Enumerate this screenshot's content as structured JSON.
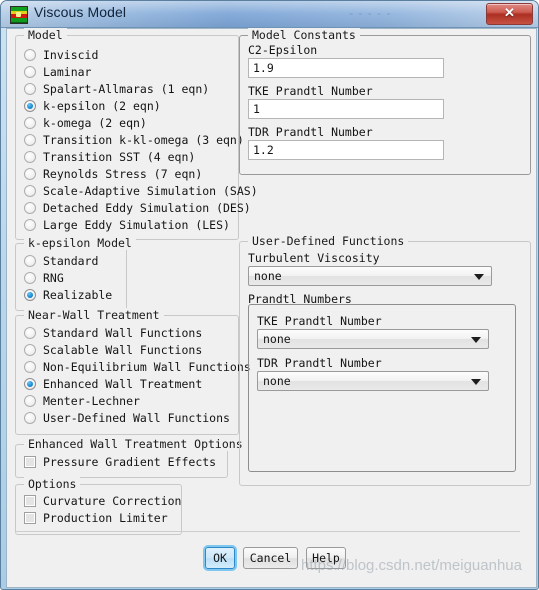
{
  "window": {
    "title": "Viscous Model",
    "icon": "contour-plot-icon",
    "ghost_text": "- - - - -",
    "close_label": "✕",
    "watermark": "https://blog.csdn.net/meiguanhua"
  },
  "model_group": {
    "title": "Model",
    "items": [
      {
        "label": "Inviscid",
        "selected": false
      },
      {
        "label": "Laminar",
        "selected": false
      },
      {
        "label": "Spalart-Allmaras (1 eqn)",
        "selected": false
      },
      {
        "label": "k-epsilon (2 eqn)",
        "selected": true
      },
      {
        "label": "k-omega (2 eqn)",
        "selected": false
      },
      {
        "label": "Transition k-kl-omega (3 eqn)",
        "selected": false
      },
      {
        "label": "Transition SST (4 eqn)",
        "selected": false
      },
      {
        "label": "Reynolds Stress (7 eqn)",
        "selected": false
      },
      {
        "label": "Scale-Adaptive Simulation (SAS)",
        "selected": false
      },
      {
        "label": "Detached Eddy Simulation (DES)",
        "selected": false
      },
      {
        "label": "Large Eddy Simulation (LES)",
        "selected": false
      }
    ]
  },
  "kepsilon_group": {
    "title": "k-epsilon Model",
    "items": [
      {
        "label": "Standard",
        "selected": false
      },
      {
        "label": "RNG",
        "selected": false
      },
      {
        "label": "Realizable",
        "selected": true
      }
    ]
  },
  "nearwall_group": {
    "title": "Near-Wall Treatment",
    "items": [
      {
        "label": "Standard Wall Functions",
        "selected": false
      },
      {
        "label": "Scalable Wall Functions",
        "selected": false
      },
      {
        "label": "Non-Equilibrium Wall Functions",
        "selected": false
      },
      {
        "label": "Enhanced Wall Treatment",
        "selected": true
      },
      {
        "label": "Menter-Lechner",
        "selected": false
      },
      {
        "label": "User-Defined Wall Functions",
        "selected": false
      }
    ]
  },
  "ewt_options_group": {
    "title": "Enhanced Wall Treatment Options",
    "items": [
      {
        "label": "Pressure Gradient Effects",
        "checked": false
      }
    ]
  },
  "options_group": {
    "title": "Options",
    "items": [
      {
        "label": "Curvature Correction",
        "checked": false
      },
      {
        "label": "Production Limiter",
        "checked": false
      }
    ]
  },
  "model_constants_group": {
    "title": "Model Constants",
    "fields": [
      {
        "label": "C2-Epsilon",
        "value": "1.9"
      },
      {
        "label": "TKE Prandtl Number",
        "value": "1"
      },
      {
        "label": "TDR Prandtl Number",
        "value": "1.2"
      }
    ]
  },
  "udf_group": {
    "title": "User-Defined Functions",
    "turbulent_viscosity": {
      "label": "Turbulent Viscosity",
      "value": "none"
    },
    "prandtl_numbers": {
      "title": "Prandtl Numbers",
      "fields": [
        {
          "label": "TKE Prandtl Number",
          "value": "none"
        },
        {
          "label": "TDR Prandtl Number",
          "value": "none"
        }
      ]
    }
  },
  "footer": {
    "buttons": [
      {
        "label": "OK",
        "focused": true
      },
      {
        "label": "Cancel",
        "focused": false
      },
      {
        "label": "Help",
        "focused": false
      }
    ]
  }
}
